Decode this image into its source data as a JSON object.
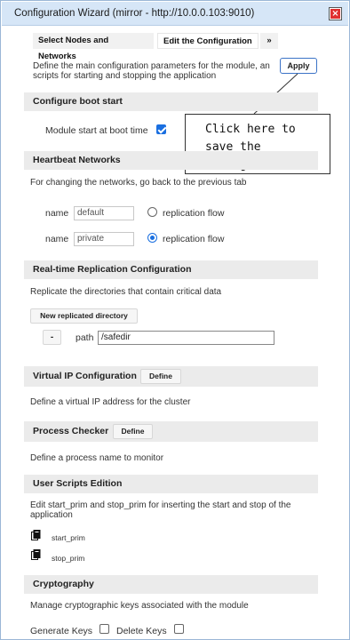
{
  "window": {
    "title": "Configuration Wizard (mirror - http://10.0.0.103:9010)"
  },
  "tabs": [
    {
      "label": "Select Nodes and Networks"
    },
    {
      "label": "Edit the Configuration"
    },
    {
      "label": "»"
    }
  ],
  "intro": {
    "line1": "Define the main configuration parameters for the module, an",
    "line2": "scripts for starting and stopping the application",
    "apply_label": "Apply"
  },
  "callout": {
    "text": "Click here to\nsave the\nconfiguration"
  },
  "boot": {
    "header": "Configure boot start",
    "label": "Module start at boot time",
    "checked": true
  },
  "heartbeat": {
    "header": "Heartbeat Networks",
    "note": "For changing the networks, go back to the previous tab",
    "networks": [
      {
        "name_label": "name",
        "value": "default",
        "replication_label": "replication flow",
        "selected": false
      },
      {
        "name_label": "name",
        "value": "private",
        "replication_label": "replication flow",
        "selected": true
      }
    ]
  },
  "replication": {
    "header": "Real-time Replication Configuration",
    "note": "Replicate the directories that contain critical data",
    "new_button": "New replicated directory",
    "remove_button": "-",
    "path_label": "path",
    "path_value": "/safedir"
  },
  "vip": {
    "header": "Virtual IP Configuration",
    "define_button": "Define",
    "note": "Define a virtual IP address for the cluster"
  },
  "process": {
    "header": "Process Checker",
    "define_button": "Define",
    "note": "Define a process name to monitor"
  },
  "scripts": {
    "header": "User Scripts Edition",
    "note_line1": "Edit start_prim and stop_prim for inserting the start and stop of the",
    "note_line2": "application",
    "items": [
      "start_prim",
      "stop_prim"
    ]
  },
  "crypto": {
    "header": "Cryptography",
    "note": "Manage cryptographic keys associated with the module",
    "generate_label": "Generate Keys",
    "delete_label": "Delete Keys"
  },
  "colors": {
    "accent": "#1a6fe0",
    "titlebar": "#d6e6f7",
    "section": "#ebebeb",
    "close": "#e03030"
  }
}
